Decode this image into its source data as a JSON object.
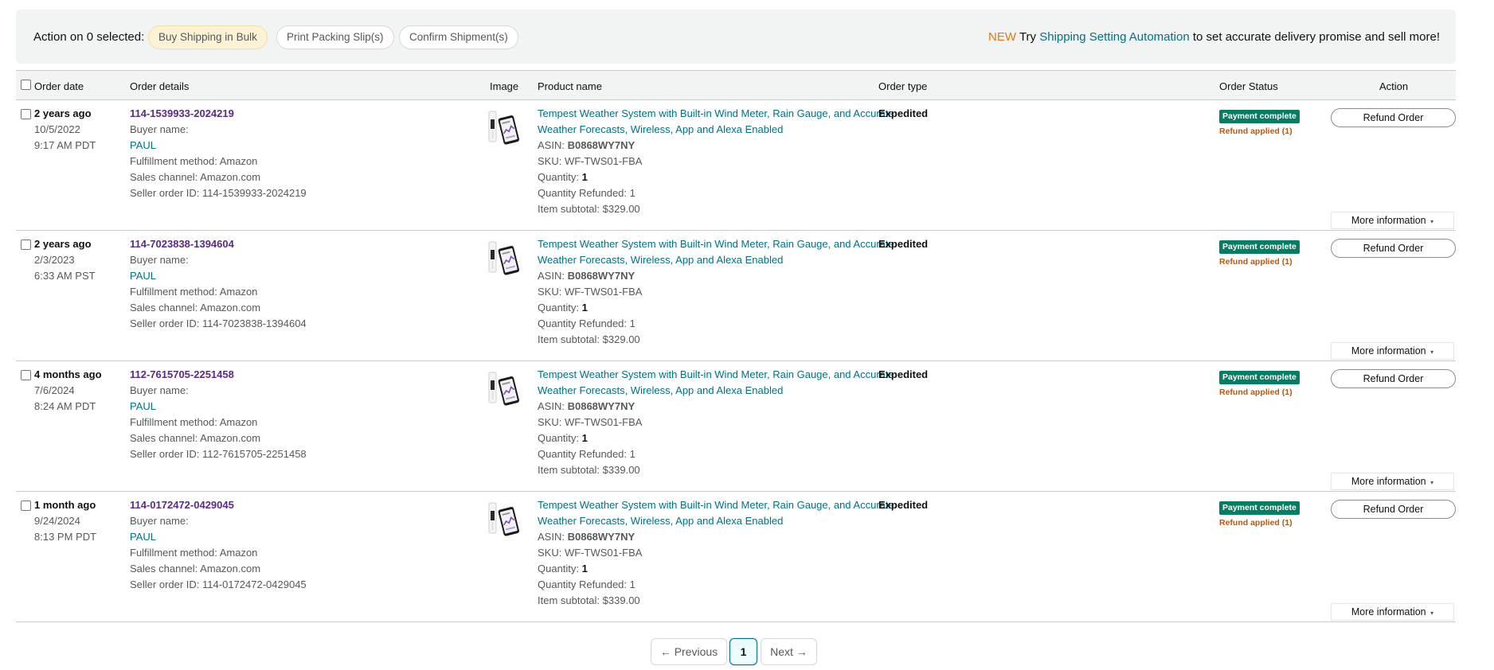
{
  "action_bar": {
    "label": "Action on 0 selected:",
    "buttons": [
      "Buy Shipping in Bulk",
      "Print Packing Slip(s)",
      "Confirm Shipment(s)"
    ],
    "promo_new": "NEW",
    "promo_try": "Try",
    "promo_link": "Shipping Setting Automation",
    "promo_rest": "to set accurate delivery promise and sell more!"
  },
  "table": {
    "headers": [
      "Order date",
      "Order details",
      "Image",
      "Product name",
      "Order type",
      "Order Status",
      "Action"
    ],
    "labels": {
      "buyer_name": "Buyer name:",
      "fulfillment": "Fulfillment method: Amazon",
      "sales_channel": "Sales channel: Amazon.com",
      "seller_order_prefix": "Seller order ID:",
      "asin": "ASIN:",
      "sku": "SKU:",
      "quantity": "Quantity:",
      "quantity_refunded": "Quantity Refunded:",
      "item_subtotal": "Item subtotal:",
      "refund_button": "Refund Order",
      "more_info": "More information",
      "more_info_caret": "▾",
      "payment_complete": "Payment complete",
      "refund_applied": "Refund applied (1)"
    },
    "rows": [
      {
        "ago": "2 years ago",
        "date": "10/5/2022",
        "time": "9:17 AM PDT",
        "order_id": "114-1539933-2024219",
        "buyer": "PAUL",
        "seller_order_id": "114-1539933-2024219",
        "product_line1": "Tempest Weather System with Built-in Wind Meter, Rain Gauge, and Accurate",
        "product_line2": "Weather Forecasts, Wireless, App and Alexa Enabled",
        "asin": "B0868WY7NY",
        "sku": "WF-TWS01-FBA",
        "quantity": "1",
        "quantity_refunded": "1",
        "subtotal": "$329.00",
        "order_type": "Expedited"
      },
      {
        "ago": "2 years ago",
        "date": "2/3/2023",
        "time": "6:33 AM PST",
        "order_id": "114-7023838-1394604",
        "buyer": "PAUL",
        "seller_order_id": "114-7023838-1394604",
        "product_line1": "Tempest Weather System with Built-in Wind Meter, Rain Gauge, and Accurate",
        "product_line2": "Weather Forecasts, Wireless, App and Alexa Enabled",
        "asin": "B0868WY7NY",
        "sku": "WF-TWS01-FBA",
        "quantity": "1",
        "quantity_refunded": "1",
        "subtotal": "$329.00",
        "order_type": "Expedited"
      },
      {
        "ago": "4 months ago",
        "date": "7/6/2024",
        "time": "8:24 AM PDT",
        "order_id": "112-7615705-2251458",
        "buyer": "PAUL",
        "seller_order_id": "112-7615705-2251458",
        "product_line1": "Tempest Weather System with Built-in Wind Meter, Rain Gauge, and Accurate",
        "product_line2": "Weather Forecasts, Wireless, App and Alexa Enabled",
        "asin": "B0868WY7NY",
        "sku": "WF-TWS01-FBA",
        "quantity": "1",
        "quantity_refunded": "1",
        "subtotal": "$339.00",
        "order_type": "Expedited"
      },
      {
        "ago": "1 month ago",
        "date": "9/24/2024",
        "time": "8:13 PM PDT",
        "order_id": "114-0172472-0429045",
        "buyer": "PAUL",
        "seller_order_id": "114-0172472-0429045",
        "product_line1": "Tempest Weather System with Built-in Wind Meter, Rain Gauge, and Accurate",
        "product_line2": "Weather Forecasts, Wireless, App and Alexa Enabled",
        "asin": "B0868WY7NY",
        "sku": "WF-TWS01-FBA",
        "quantity": "1",
        "quantity_refunded": "1",
        "subtotal": "$339.00",
        "order_type": "Expedited"
      }
    ]
  },
  "pagination": {
    "previous": "← Previous",
    "current": "1",
    "next": "Next →"
  },
  "colors": {
    "link": "#007185",
    "order_id": "#5a2b86",
    "payment_complete": "#067d62",
    "refund_applied": "#c45500",
    "new_tag": "#e47911"
  }
}
